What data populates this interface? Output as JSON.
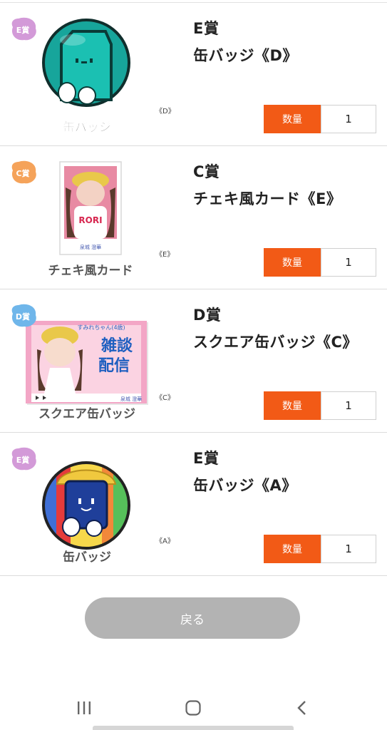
{
  "items": [
    {
      "prize": "E賞",
      "name": "缶バッジ《D》",
      "thumb_caption": "缶バッジ",
      "thumb_code": "《D》",
      "badge_label": "E賞",
      "qty_label": "数量",
      "qty_value": "1",
      "colors": {
        "badge": "#d39ad8",
        "main": "#17a59b"
      }
    },
    {
      "prize": "C賞",
      "name": "チェキ風カード《E》",
      "thumb_caption": "チェキ風カード",
      "thumb_code": "《E》",
      "badge_label": "C賞",
      "card_text": "RORI",
      "card_signature": "泉城 澄華",
      "qty_label": "数量",
      "qty_value": "1",
      "colors": {
        "badge": "#f5a35a",
        "main": "#e88aa3"
      }
    },
    {
      "prize": "D賞",
      "name": "スクエア缶バッジ《C》",
      "thumb_caption": "スクエア缶バッジ",
      "thumb_code": "《C》",
      "badge_label": "D賞",
      "card_text_1": "雑談",
      "card_text_2": "配信",
      "card_header": "すみれちゃん(4歳)",
      "card_signature": "泉城 澄華",
      "qty_label": "数量",
      "qty_value": "1",
      "colors": {
        "badge": "#6fb6ea",
        "main": "#f3a6c6"
      }
    },
    {
      "prize": "E賞",
      "name": "缶バッジ《A》",
      "thumb_caption": "缶バッジ",
      "thumb_code": "《A》",
      "badge_label": "E賞",
      "qty_label": "数量",
      "qty_value": "1",
      "colors": {
        "badge": "#d39ad8",
        "main": "#1f3f9a"
      }
    }
  ],
  "back_button": "戻る",
  "nav": {
    "recents": "recents-icon",
    "home": "home-icon",
    "back": "back-icon"
  },
  "accent": "#f25a16"
}
